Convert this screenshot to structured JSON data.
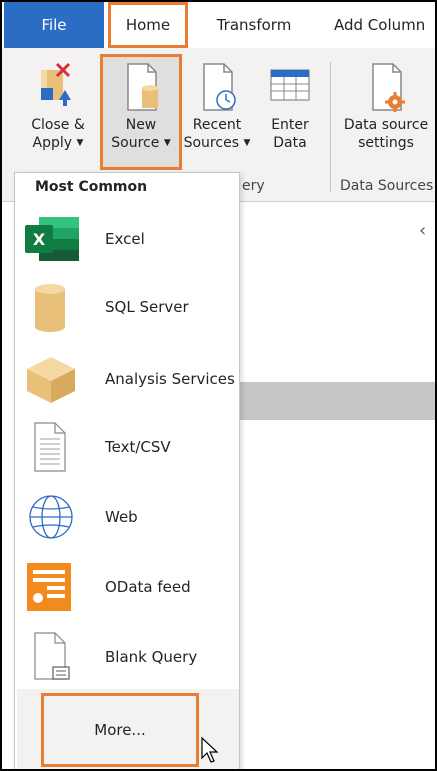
{
  "tabs": {
    "file": "File",
    "home": "Home",
    "transform": "Transform",
    "add_column": "Add Column"
  },
  "ribbon": {
    "close_apply": {
      "line1": "Close &",
      "line2": "Apply"
    },
    "new_source": {
      "line1": "New",
      "line2": "Source"
    },
    "recent_sources": {
      "line1": "Recent",
      "line2": "Sources"
    },
    "enter_data": {
      "line1": "Enter",
      "line2": "Data"
    },
    "data_source_settings": {
      "line1": "Data source",
      "line2": "settings"
    },
    "group_query_partial": "ery",
    "group_data_sources": "Data Sources"
  },
  "menu": {
    "header": "Most Common",
    "items": [
      {
        "label": "Excel",
        "icon": "excel-icon"
      },
      {
        "label": "SQL Server",
        "icon": "sql-server-icon"
      },
      {
        "label": "Analysis Services",
        "icon": "analysis-services-icon"
      },
      {
        "label": "Text/CSV",
        "icon": "text-csv-icon"
      },
      {
        "label": "Web",
        "icon": "web-globe-icon"
      },
      {
        "label": "OData feed",
        "icon": "odata-feed-icon"
      },
      {
        "label": "Blank Query",
        "icon": "blank-query-icon"
      }
    ],
    "more": "More..."
  },
  "colors": {
    "accent_blue": "#2b6cc4",
    "highlight_orange": "#ea7d35",
    "excel_green": "#1e7145",
    "cylinder_tan": "#e8c07a",
    "odata_orange": "#f28a1e"
  }
}
